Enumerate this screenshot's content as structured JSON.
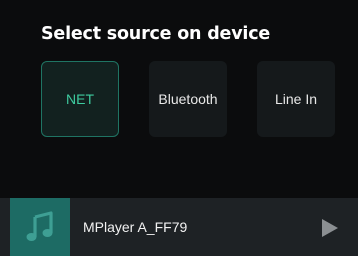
{
  "header": {
    "title": "Select source on device"
  },
  "sources": [
    {
      "label": "NET",
      "selected": true
    },
    {
      "label": "Bluetooth",
      "selected": false
    },
    {
      "label": "Line In",
      "selected": false
    }
  ],
  "player": {
    "track": "MPlayer A_FF79",
    "cover_icon": "music-note-icon",
    "play_icon": "play-icon"
  },
  "colors": {
    "background": "#0b0c0d",
    "selected_accent": "#3ecb9f",
    "selected_border": "#1f7463",
    "tile_background": "#15191b",
    "player_bar": "#1e2225",
    "cover_background": "#1d6b64"
  }
}
